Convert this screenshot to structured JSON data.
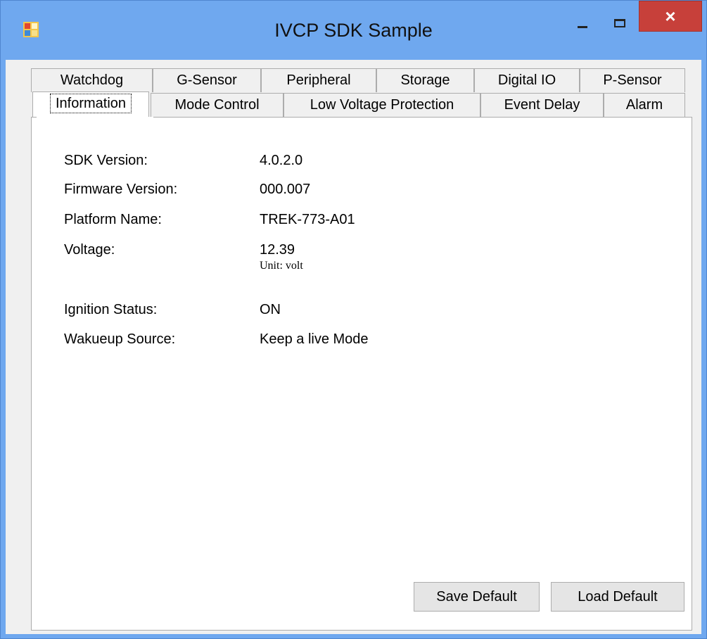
{
  "window": {
    "title": "IVCP SDK Sample",
    "close_glyph": "×"
  },
  "tabs": {
    "row1": [
      "Watchdog",
      "G-Sensor",
      "Peripheral",
      "Storage",
      "Digital IO",
      "P-Sensor"
    ],
    "row2": [
      "Information",
      "Mode Control",
      "Low Voltage Protection",
      "Event Delay",
      "Alarm"
    ],
    "selected": "Information"
  },
  "information": {
    "sdk_version_label": "SDK Version:",
    "sdk_version_value": "4.0.2.0",
    "firmware_version_label": "Firmware Version:",
    "firmware_version_value": "000.007",
    "platform_name_label": "Platform Name:",
    "platform_name_value": "TREK-773-A01",
    "voltage_label": "Voltage:",
    "voltage_value": "12.39",
    "voltage_unit": "Unit: volt",
    "ignition_status_label": "Ignition Status:",
    "ignition_status_value": "ON",
    "wakeup_source_label": "Wakueup Source:",
    "wakeup_source_value": "Keep a live Mode"
  },
  "buttons": {
    "save_default": "Save Default",
    "load_default": "Load Default"
  },
  "icons": {
    "app": "app-window-icon",
    "minimize": "minimize-icon",
    "maximize": "maximize-icon",
    "close": "close-icon"
  },
  "colors": {
    "titlebar": "#6fa8ef",
    "close_button": "#c7403a",
    "panel": "#ffffff",
    "client": "#f0f0f0"
  }
}
